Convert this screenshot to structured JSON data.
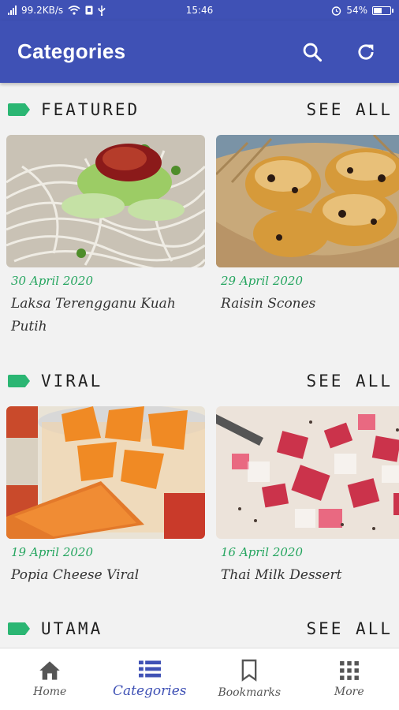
{
  "status": {
    "network_speed": "99.2KB/s",
    "time": "15:46",
    "battery": "54%",
    "battery_level": 0.54
  },
  "appbar": {
    "title": "Categories",
    "search_icon": "search-icon",
    "refresh_icon": "refresh-icon"
  },
  "accent_color": "#2bb673",
  "primary_color": "#3f51b5",
  "sections": [
    {
      "title": "FEATURED",
      "see_all": "SEE ALL",
      "items": [
        {
          "date": "30 April 2020",
          "name": "Laksa Terengganu Kuah Putih"
        },
        {
          "date": "29 April 2020",
          "name": "Raisin Scones"
        }
      ]
    },
    {
      "title": "VIRAL",
      "see_all": "SEE ALL",
      "items": [
        {
          "date": "19 April 2020",
          "name": "Popia Cheese Viral"
        },
        {
          "date": "16 April 2020",
          "name": "Thai Milk Dessert"
        }
      ]
    },
    {
      "title": "UTAMA",
      "see_all": "SEE ALL"
    }
  ],
  "bottom_nav": [
    {
      "label": "Home",
      "icon": "home-icon"
    },
    {
      "label": "Categories",
      "icon": "list-icon"
    },
    {
      "label": "Bookmarks",
      "icon": "bookmark-icon"
    },
    {
      "label": "More",
      "icon": "grid-icon"
    }
  ]
}
